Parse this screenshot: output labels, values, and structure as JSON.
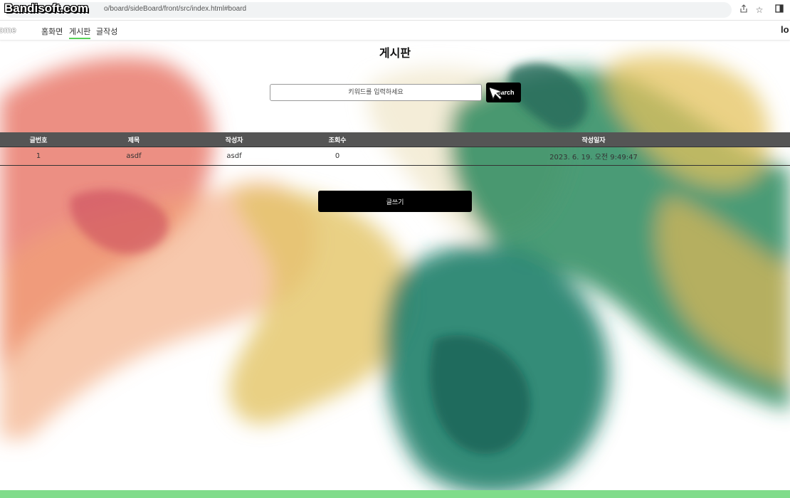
{
  "browser": {
    "url": "o/board/sideBoard/front/src/index.html#board",
    "watermark": "Bandisoft.com",
    "icons": [
      "share-icon",
      "star-icon",
      "sidebar-toggle-icon"
    ]
  },
  "nav": {
    "brand": "ome",
    "links": [
      "홈화면",
      "게시판",
      "글작성"
    ],
    "active": "게시판",
    "login_label": "lo"
  },
  "page": {
    "title": "게시판"
  },
  "search": {
    "placeholder": "키워드를 입력하세요",
    "button_label": "Search"
  },
  "table": {
    "columns": [
      "글번호",
      "제목",
      "작성자",
      "조회수",
      "작성일자"
    ],
    "rows": [
      [
        "1",
        "asdf",
        "asdf",
        "0",
        "2023. 6. 19. 오전 9:49:47"
      ]
    ]
  },
  "actions": {
    "write_label": "글쓰기"
  },
  "colors": {
    "accent": "#57d057",
    "header_bg": "#555555",
    "button_bg": "#000000",
    "footer": "#7fdc8a"
  }
}
